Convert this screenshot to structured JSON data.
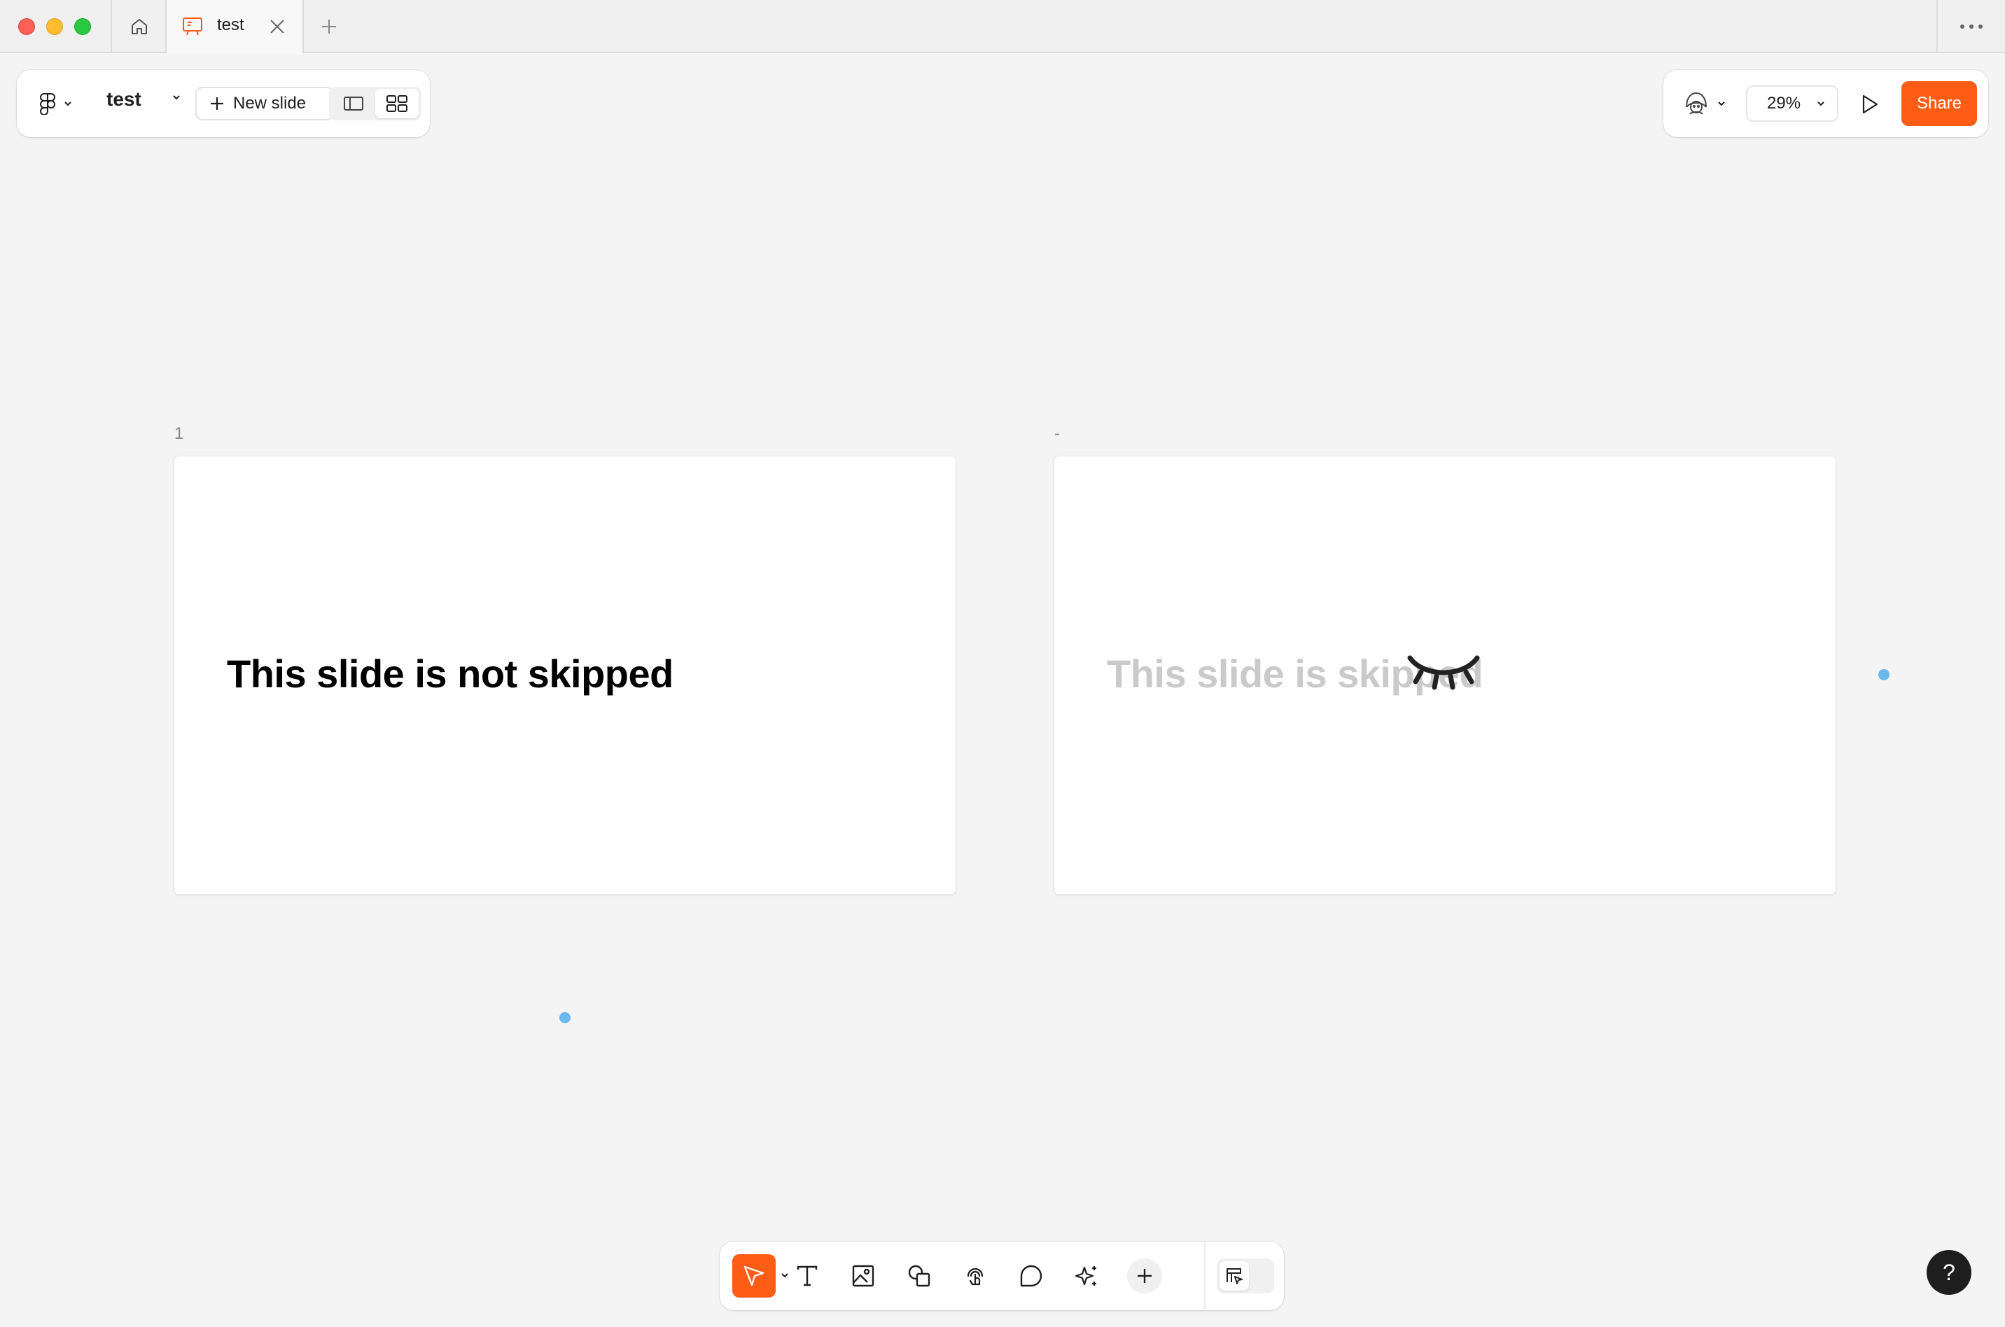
{
  "titlebar": {
    "tab_title": "test",
    "icons": [
      "home-icon",
      "slides-tab-icon",
      "close-icon",
      "plus-icon",
      "more-icon"
    ]
  },
  "toolbar": {
    "file_name": "test",
    "new_slide_label": "New slide",
    "view_modes": [
      "single-slide-view",
      "grid-view"
    ],
    "active_view": "grid-view"
  },
  "right_toolbar": {
    "zoom": "29%",
    "share_label": "Share"
  },
  "slides": [
    {
      "number": "1",
      "heading": "This slide is not skipped",
      "skipped": false
    },
    {
      "number": "-",
      "heading": "This slide is skipped",
      "skipped": true
    }
  ],
  "bottom_toolbar": {
    "tools": [
      "move",
      "text",
      "image",
      "shapes",
      "interaction",
      "comment",
      "ai",
      "add"
    ],
    "active_tool": "move"
  },
  "help": {
    "label": "?"
  },
  "colors": {
    "accent": "#ff5c16",
    "canvas": "#f4f4f4",
    "skipped_text": "#cacaca",
    "selection_dot": "#6bb8ef"
  }
}
